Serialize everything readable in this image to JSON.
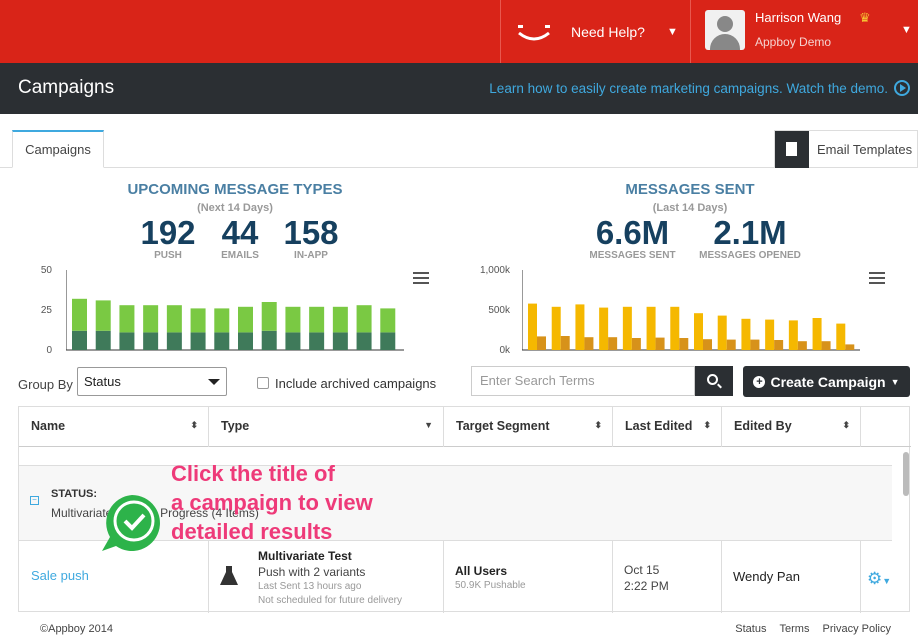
{
  "topbar": {
    "help_label": "Need Help?",
    "user_name": "Harrison Wang",
    "user_org": "Appboy Demo"
  },
  "header": {
    "title": "Campaigns",
    "demo_link": "Learn how to easily create marketing campaigns. Watch the demo."
  },
  "tabs": {
    "campaigns": "Campaigns",
    "email_templates": "Email Templates"
  },
  "upcoming": {
    "title": "UPCOMING MESSAGE TYPES",
    "subtitle": "(Next 14 Days)",
    "push": "192",
    "push_label": "PUSH",
    "emails": "44",
    "emails_label": "EMAILS",
    "inapp": "158",
    "inapp_label": "IN-APP"
  },
  "sent": {
    "title": "MESSAGES SENT",
    "subtitle": "(Last 14 Days)",
    "sent": "6.6M",
    "sent_label": "MESSAGES SENT",
    "opened": "2.1M",
    "opened_label": "MESSAGES OPENED"
  },
  "chart_data": [
    {
      "type": "bar",
      "stacked": true,
      "ylim": [
        0,
        50
      ],
      "yticks": [
        "50",
        "25",
        "0"
      ],
      "series": [
        {
          "values": [
            12,
            12,
            11,
            11,
            11,
            11,
            11,
            11,
            12,
            11,
            11,
            11,
            11,
            11
          ],
          "color": "#3f7a5a"
        },
        {
          "values": [
            20,
            19,
            17,
            17,
            17,
            15,
            15,
            16,
            18,
            16,
            16,
            16,
            17,
            15
          ],
          "color": "#7ac943"
        }
      ]
    },
    {
      "type": "bar",
      "ylim": [
        0,
        1000
      ],
      "yticks": [
        "1,000k",
        "500k",
        "0k"
      ],
      "series": [
        {
          "values": [
            580,
            540,
            570,
            530,
            540,
            540,
            540,
            460,
            430,
            390,
            380,
            370,
            400,
            330
          ],
          "color": "#f5b800"
        },
        {
          "values": [
            170,
            175,
            160,
            160,
            150,
            155,
            150,
            135,
            130,
            130,
            125,
            110,
            110,
            70
          ],
          "color": "#d7921a"
        }
      ]
    }
  ],
  "filters": {
    "group_by_label": "Group By",
    "group_by_value": "Status",
    "archived_label": "Include archived campaigns",
    "search_placeholder": "Enter Search Terms",
    "create_label": "Create Campaign"
  },
  "table": {
    "headers": [
      "Name",
      "Type",
      "Target Segment",
      "Last Edited",
      "Edited By"
    ],
    "group_label": "STATUS:",
    "group_value": "Multivariate Tests In Progress (4 Items)",
    "row": {
      "name": "Sale push",
      "type_title": "Multivariate Test",
      "type_sub": "Push with 2 variants",
      "type_last": "Last Sent 13 hours ago",
      "type_sched": "Not scheduled for future delivery",
      "segment": "All Users",
      "segment_sub": "50.9K Pushable",
      "date": "Oct 15",
      "time": "2:22 PM",
      "editor": "Wendy Pan"
    }
  },
  "callout": {
    "line1": "Click the title of",
    "line2": "a campaign to view",
    "line3": "detailed results"
  },
  "footer": {
    "copyright": "©Appboy 2014",
    "status": "Status",
    "terms": "Terms",
    "privacy": "Privacy Policy"
  }
}
